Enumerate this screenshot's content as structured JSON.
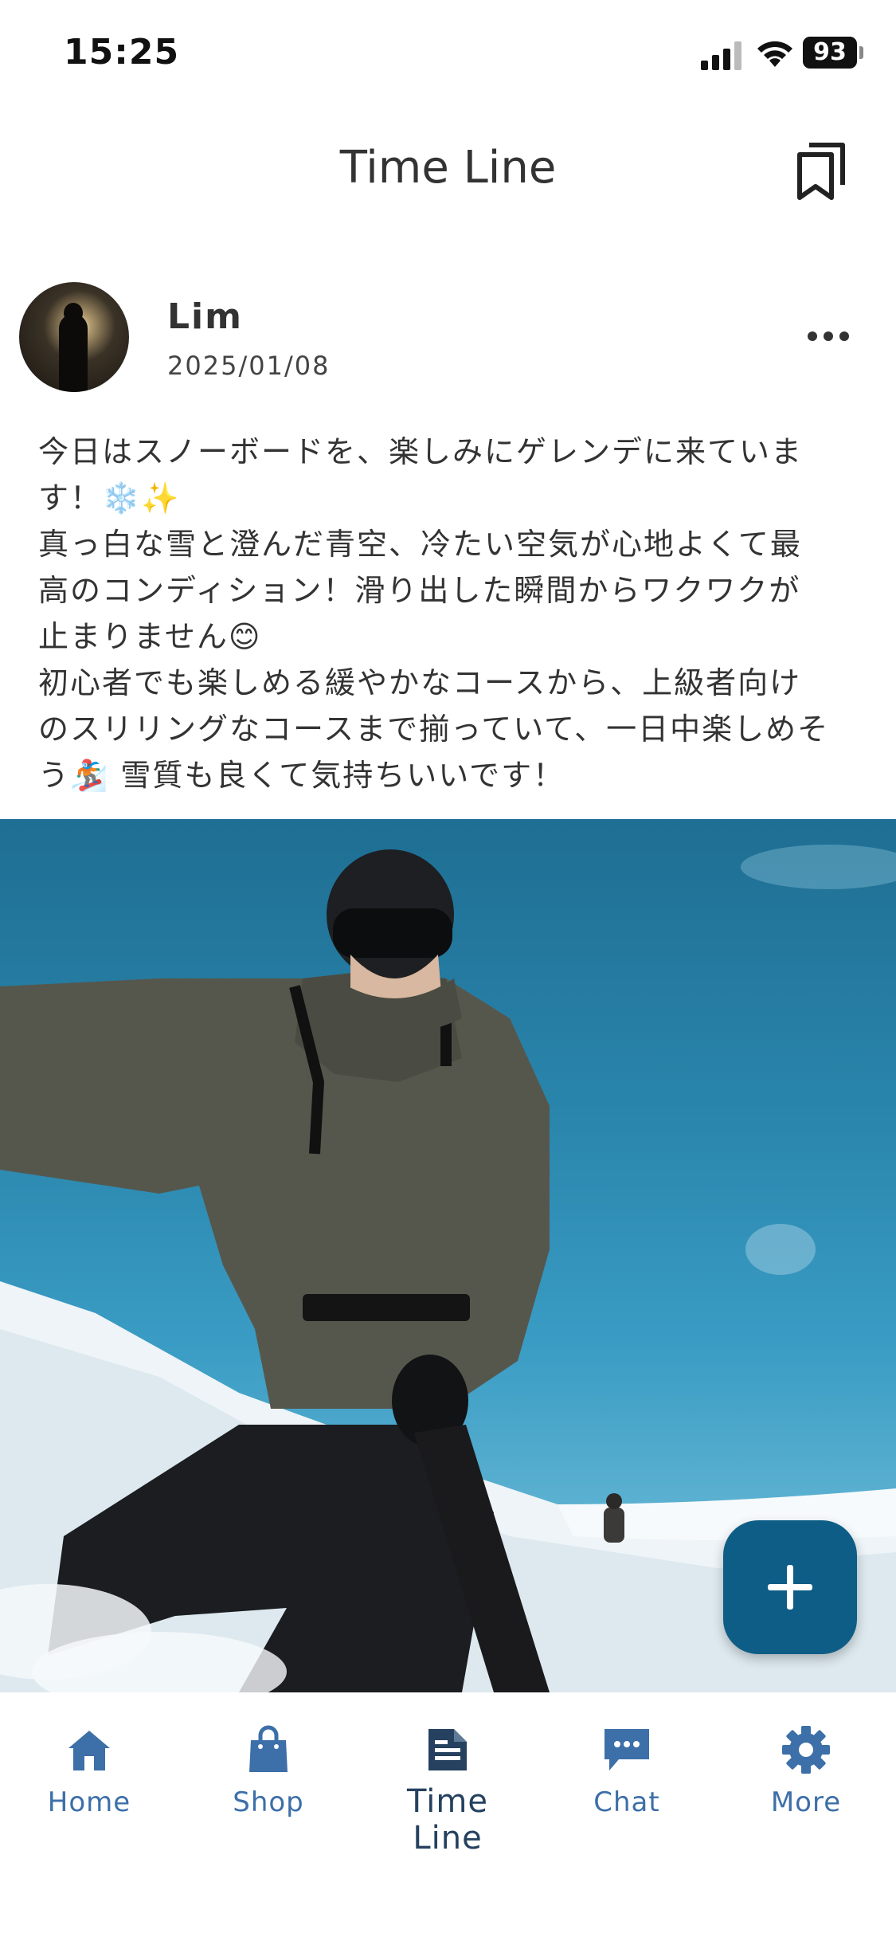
{
  "status_bar": {
    "time": "15:25",
    "battery": "93"
  },
  "header": {
    "title": "Time Line"
  },
  "post": {
    "username": "Lim",
    "date": "2025/01/08",
    "text_lines": [
      "今日はスノーボードを、楽しみにゲレンデに来ていま",
      "す！❄️✨",
      "真っ白な雪と澄んだ青空、冷たい空気が心地よくて最",
      "高のコンディション！滑り出した瞬間からワクワクが",
      "止まりません😊",
      "初心者でも楽しめる緩やかなコースから、上級者向け",
      "のスリリングなコースまで揃っていて、一日中楽しめそ",
      "う🏂 雪質も良くて気持ちいいです！"
    ]
  },
  "nav": {
    "home": "Home",
    "shop": "Shop",
    "timeline": "Time Line",
    "chat": "Chat",
    "more": "More"
  },
  "colors": {
    "accent": "#0d5d86",
    "nav": "#3d6fa8",
    "nav_active": "#25415f"
  }
}
